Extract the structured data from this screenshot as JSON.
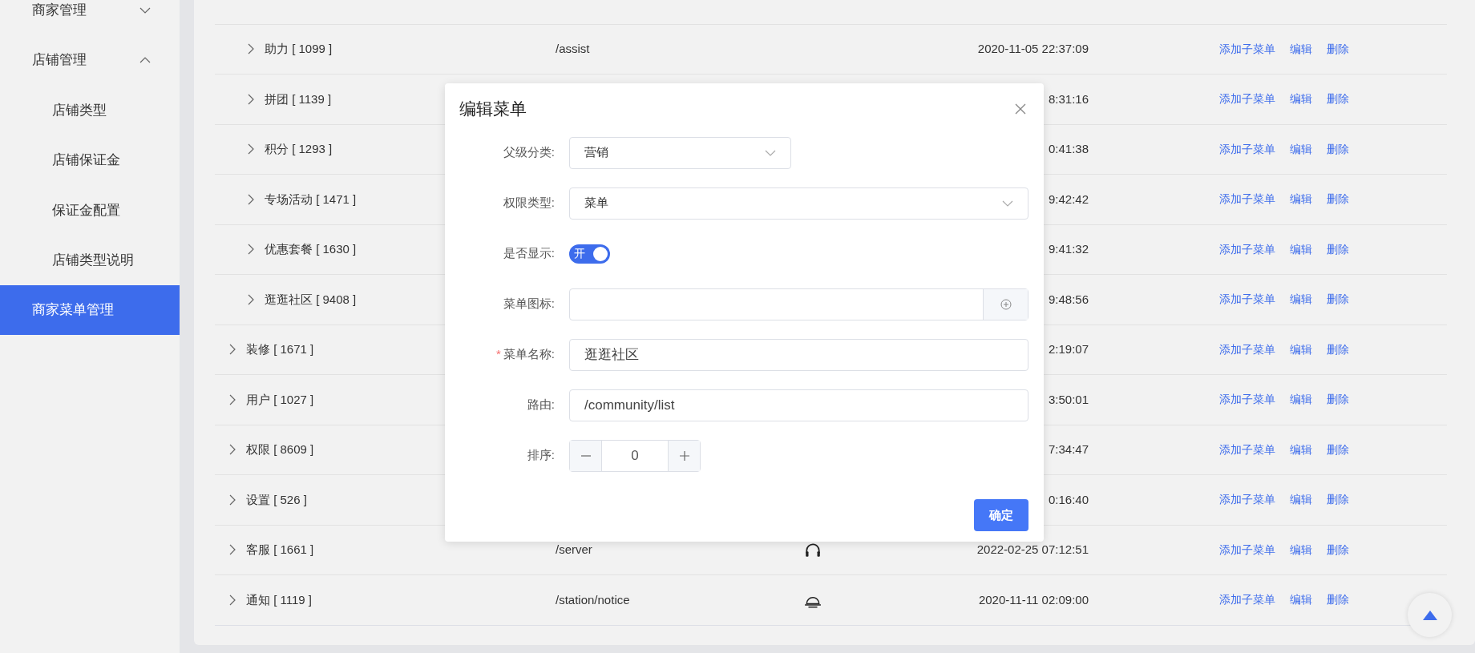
{
  "sidebar": {
    "items": [
      {
        "label": "商家管理",
        "expanded": false,
        "selected": false
      },
      {
        "label": "店铺管理",
        "expanded": true,
        "selected": false,
        "children": [
          {
            "label": "店铺类型",
            "selected": false
          },
          {
            "label": "店铺保证金",
            "selected": false
          },
          {
            "label": "保证金配置",
            "selected": false
          },
          {
            "label": "店铺类型说明",
            "selected": false
          }
        ]
      },
      {
        "label": "商家菜单管理",
        "selected": true
      }
    ]
  },
  "table": {
    "rows": [
      {
        "children": [
          {
            "name": "助力 [ 1099 ]",
            "route": "/assist",
            "time": "2020-11-05 22:37:09",
            "actions": [
              "添加子菜单",
              "编辑",
              "删除"
            ]
          },
          {
            "name": "拼团 [ 1139 ]",
            "time": "8:31:16",
            "actions": [
              "添加子菜单",
              "编辑",
              "删除"
            ]
          },
          {
            "name": "积分 [ 1293 ]",
            "time": "0:41:38",
            "actions": [
              "添加子菜单",
              "编辑",
              "删除"
            ]
          },
          {
            "name": "专场活动 [ 1471 ]",
            "time": "9:42:42",
            "actions": [
              "添加子菜单",
              "编辑",
              "删除"
            ]
          },
          {
            "name": "优惠套餐 [ 1630 ]",
            "time": "9:41:32",
            "actions": [
              "添加子菜单",
              "编辑",
              "删除"
            ]
          },
          {
            "name": "逛逛社区 [ 9408 ]",
            "time": "9:48:56",
            "actions": [
              "添加子菜单",
              "编辑",
              "删除"
            ]
          }
        ]
      },
      {
        "name": "装修 [ 1671 ]",
        "time": "2:19:07",
        "actions": [
          "添加子菜单",
          "编辑",
          "删除"
        ]
      },
      {
        "name": "用户 [ 1027 ]",
        "time": "3:50:01",
        "actions": [
          "添加子菜单",
          "编辑",
          "删除"
        ]
      },
      {
        "name": "权限 [ 8609 ]",
        "time": "7:34:47",
        "actions": [
          "添加子菜单",
          "编辑",
          "删除"
        ]
      },
      {
        "name": "设置 [ 526 ]",
        "time": "0:16:40",
        "actions": [
          "添加子菜单",
          "编辑",
          "删除"
        ]
      },
      {
        "name": "客服 [ 1661 ]",
        "route": "/server",
        "kind": "headset",
        "time": "2022-02-25 07:12:51",
        "actions": [
          "添加子菜单",
          "编辑",
          "删除"
        ]
      },
      {
        "name": "通知 [ 1119 ]",
        "route": "/station/notice",
        "kind": "bell",
        "time": "2020-11-11 02:09:00",
        "actions": [
          "添加子菜单",
          "编辑",
          "删除"
        ]
      }
    ]
  },
  "dialog": {
    "title": "编辑菜单",
    "fields": [
      {
        "kind": "cascader",
        "label": "父级分类:",
        "value": "营销",
        "required": false
      },
      {
        "kind": "select",
        "label": "权限类型:",
        "value": "菜单",
        "required": false
      },
      {
        "kind": "switch",
        "label": "是否显示:",
        "on": true,
        "text": "开",
        "required": false
      },
      {
        "kind": "icon_picker",
        "label": "菜单图标:",
        "required": false
      },
      {
        "kind": "text",
        "label": "菜单名称:",
        "value": "逛逛社区",
        "required": true
      },
      {
        "kind": "text",
        "label": "路由:",
        "value": "/community/list",
        "required": false
      },
      {
        "kind": "number",
        "label": "排序:",
        "value": "0",
        "required": false
      }
    ],
    "required_mark": "*",
    "confirm": "确定"
  }
}
